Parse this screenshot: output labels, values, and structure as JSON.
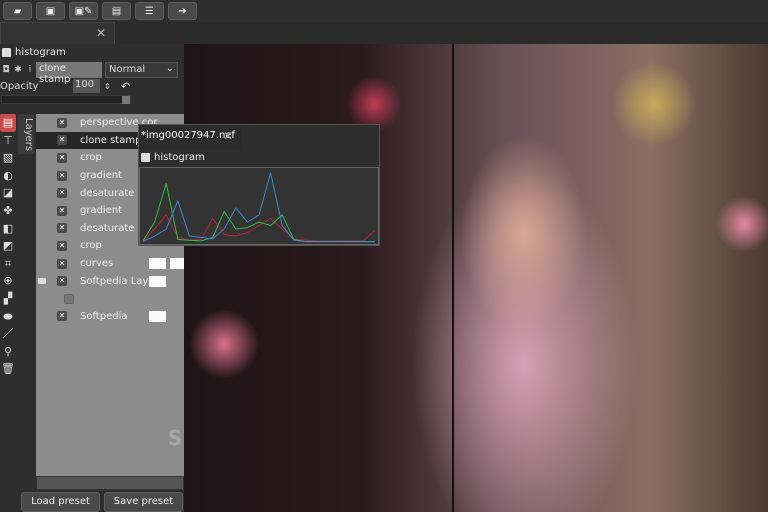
{
  "toolbar": {
    "buttons": [
      {
        "icon": "folder-open-icon"
      },
      {
        "icon": "save-icon"
      },
      {
        "icon": "save-as-icon"
      },
      {
        "icon": "export-icon"
      },
      {
        "icon": "preferences-icon"
      },
      {
        "icon": "quit-icon"
      }
    ]
  },
  "tab": {
    "close": "✕"
  },
  "module": {
    "title": "histogram",
    "instance_name": "clone stamp",
    "blend_mode": "Normal",
    "opacity_label": "Opacity",
    "opacity_value": "100",
    "opacity_level": 100
  },
  "layers_tab": "Layers",
  "layers": [
    {
      "name": "perspective cor"
    },
    {
      "name": "clone stamp",
      "selected": true
    },
    {
      "name": "crop"
    },
    {
      "name": "gradient"
    },
    {
      "name": "desaturate"
    },
    {
      "name": "gradient"
    },
    {
      "name": "desaturate"
    },
    {
      "name": "crop"
    },
    {
      "name": "curves",
      "swatches": 2
    },
    {
      "name": "Softpedia Layer",
      "swatches": 1,
      "group": true
    },
    {
      "name": "",
      "checkbox": true
    },
    {
      "name": "Softpedia",
      "swatches": 1
    }
  ],
  "buttons": {
    "load_preset": "Load preset",
    "save_preset": "Save preset"
  },
  "image_tab": {
    "title": "*img00027947.nef",
    "close": "✕"
  },
  "histogram_panel": {
    "title": "histogram"
  },
  "watermark": "S",
  "chart_data": {
    "type": "line",
    "title": "histogram",
    "x": [
      0,
      5,
      10,
      15,
      20,
      25,
      30,
      35,
      40,
      45,
      50,
      55,
      60,
      65,
      70,
      75,
      80,
      85,
      90,
      95,
      100
    ],
    "series": [
      {
        "color": "#c0203a",
        "values": [
          2,
          20,
          40,
          8,
          4,
          5,
          35,
          12,
          10,
          15,
          25,
          35,
          20,
          6,
          4,
          3,
          3,
          3,
          3,
          3,
          18
        ]
      },
      {
        "color": "#30c040",
        "values": [
          3,
          30,
          85,
          5,
          4,
          3,
          8,
          45,
          20,
          22,
          30,
          25,
          40,
          5,
          2,
          2,
          2,
          2,
          2,
          2,
          2
        ]
      },
      {
        "color": "#3a8ad0",
        "values": [
          2,
          10,
          20,
          60,
          10,
          8,
          6,
          20,
          50,
          30,
          40,
          100,
          25,
          4,
          2,
          2,
          2,
          2,
          2,
          2,
          2
        ]
      }
    ]
  }
}
